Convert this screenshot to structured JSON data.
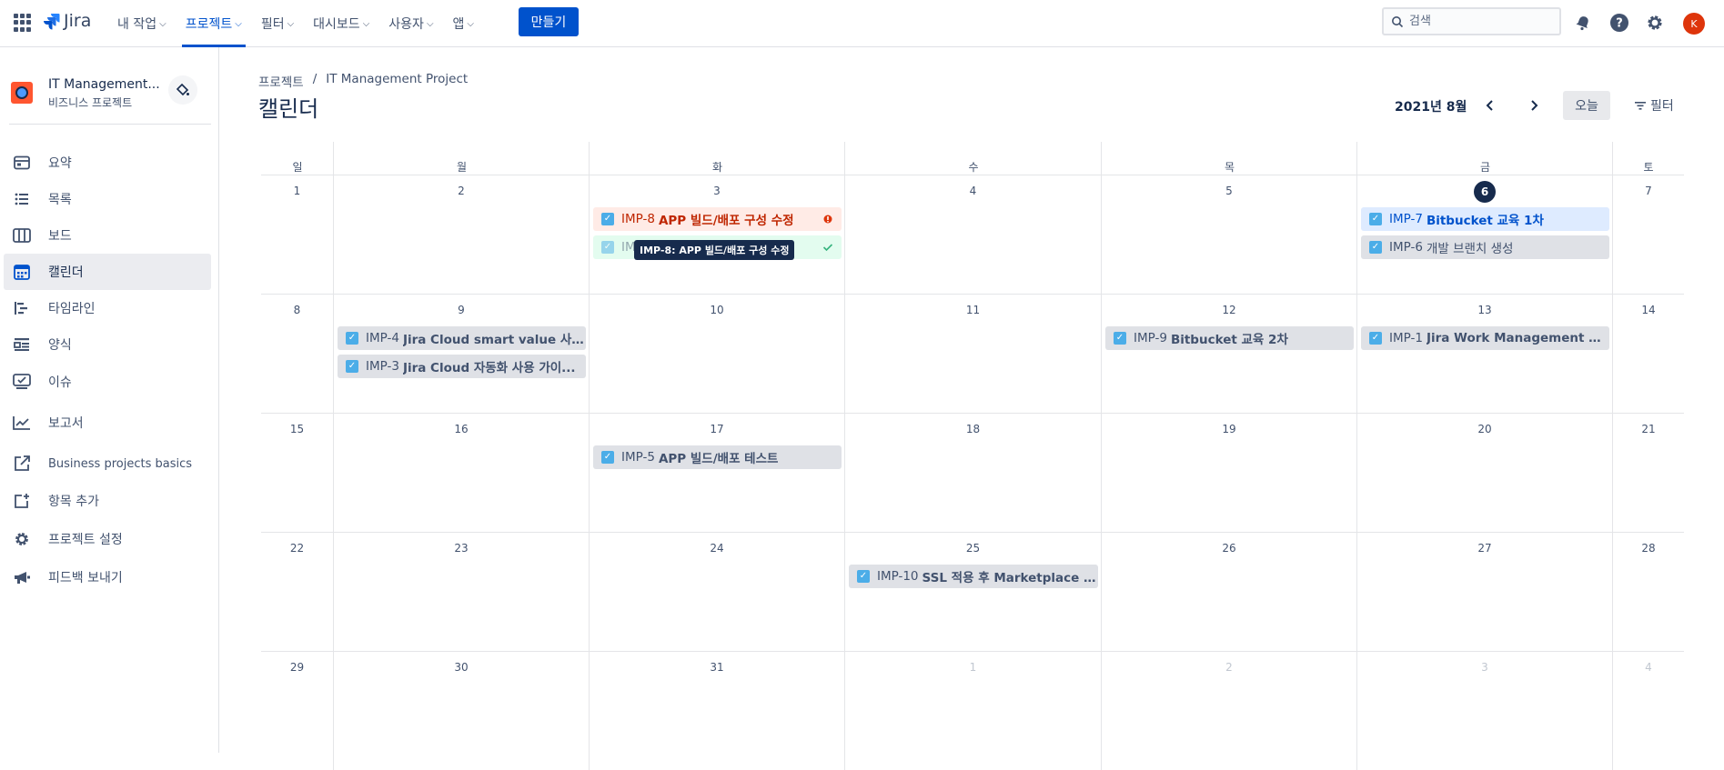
{
  "topnav": {
    "app_name": "Jira",
    "items": [
      {
        "label": "내 작업"
      },
      {
        "label": "프로젝트"
      },
      {
        "label": "필터"
      },
      {
        "label": "대시보드"
      },
      {
        "label": "사용자"
      },
      {
        "label": "앱"
      }
    ],
    "active_item": "프로젝트",
    "create_label": "만들기",
    "search_placeholder": "검색",
    "avatar_initial": "K",
    "icons": [
      "app-switcher-icon",
      "search-icon",
      "notification-icon",
      "help-icon",
      "settings-icon"
    ]
  },
  "sidebar": {
    "project_name": "IT Management...",
    "project_type": "비즈니스 프로젝트",
    "items": [
      {
        "label": "요약",
        "icon": "summary-icon"
      },
      {
        "label": "목록",
        "icon": "list-icon"
      },
      {
        "label": "보드",
        "icon": "board-icon"
      },
      {
        "label": "캘린더",
        "icon": "calendar-icon"
      },
      {
        "label": "타임라인",
        "icon": "timeline-icon"
      },
      {
        "label": "양식",
        "icon": "form-icon"
      },
      {
        "label": "이슈",
        "icon": "issues-icon"
      },
      {
        "label": "보고서",
        "icon": "reports-icon"
      },
      {
        "label": "Business projects basics",
        "icon": "external-link-icon"
      },
      {
        "label": "항목 추가",
        "icon": "add-item-icon"
      },
      {
        "label": "프로젝트 설정",
        "icon": "settings-icon"
      },
      {
        "label": "피드백 보내기",
        "icon": "megaphone-icon"
      }
    ],
    "active_item": "캘린더"
  },
  "header": {
    "breadcrumbs": [
      "프로젝트",
      "/",
      "IT Management Project"
    ],
    "title": "캘린더",
    "month": "2021년 8월",
    "today_label": "오늘",
    "filter_label": "필터"
  },
  "calendar": {
    "weekdays": [
      "일",
      "월",
      "화",
      "수",
      "목",
      "금",
      "토"
    ],
    "weeks": [
      [
        "1",
        "2",
        "3",
        "4",
        "5",
        "6",
        "7"
      ],
      [
        "8",
        "9",
        "10",
        "11",
        "12",
        "13",
        "14"
      ],
      [
        "15",
        "16",
        "17",
        "18",
        "19",
        "20",
        "21"
      ],
      [
        "22",
        "23",
        "24",
        "25",
        "26",
        "27",
        "28"
      ],
      [
        "29",
        "30",
        "31",
        "1",
        "2",
        "3",
        "4"
      ]
    ],
    "today": "6",
    "events": [
      {
        "key": "IMP-8",
        "summary": "APP 빌드/배포 구성 수정",
        "week": 0,
        "day": 2,
        "row": 0,
        "style": "red",
        "end_icon": "error-icon"
      },
      {
        "key": "IM",
        "summary": "",
        "week": 0,
        "day": 2,
        "row": 1,
        "style": "green",
        "end_icon": "check-icon"
      },
      {
        "key": "IMP-7",
        "summary": "Bitbucket 교육 1차",
        "week": 0,
        "day": 5,
        "row": 0,
        "style": "blue"
      },
      {
        "key": "IMP-6",
        "summary": "개발 브랜치 생성",
        "week": 0,
        "day": 5,
        "row": 1,
        "style": "gray",
        "plain": true
      },
      {
        "key": "IMP-4",
        "summary": "Jira Cloud smart value 사용 ...",
        "week": 1,
        "day": 1,
        "row": 0,
        "style": "gray"
      },
      {
        "key": "IMP-3",
        "summary": "Jira Cloud 자동화 사용 가이...",
        "week": 1,
        "day": 1,
        "row": 1,
        "style": "gray"
      },
      {
        "key": "IMP-9",
        "summary": "Bitbucket 교육 2차",
        "week": 1,
        "day": 4,
        "row": 0,
        "style": "gray"
      },
      {
        "key": "IMP-1",
        "summary": "Jira Work Management Clou...",
        "week": 1,
        "day": 5,
        "row": 0,
        "style": "gray"
      },
      {
        "key": "IMP-5",
        "summary": "APP 빌드/배포 테스트",
        "week": 2,
        "day": 2,
        "row": 0,
        "style": "gray"
      },
      {
        "key": "IMP-10",
        "summary": "SSL 적용 후 Marketplace 접...",
        "week": 3,
        "day": 3,
        "row": 0,
        "style": "gray"
      }
    ],
    "tooltip": "IMP-8: APP 빌드/배포 구성 수정"
  },
  "colors": {
    "accent": "#0052cc",
    "today": "#172b4d",
    "checkbox": "#4bade8",
    "avatar": "#de350b"
  }
}
